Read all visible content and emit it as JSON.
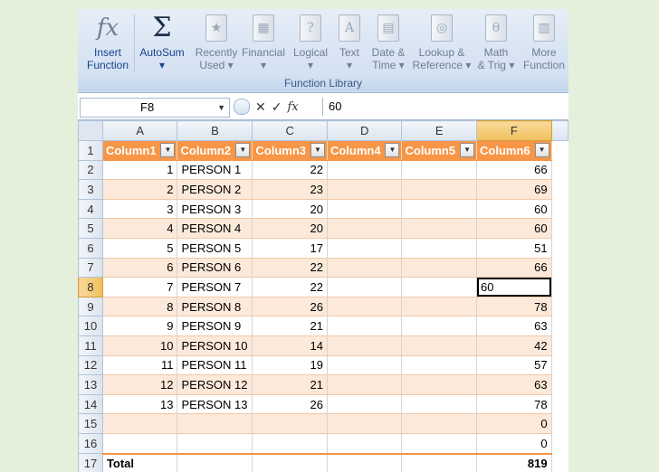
{
  "ribbon": {
    "buttons": [
      {
        "line1": "Insert",
        "line2": "Function",
        "icon": "function-icon"
      },
      {
        "line1": "AutoSum",
        "line2": "▾",
        "icon": "sigma-icon"
      },
      {
        "line1": "Recently",
        "line2": "Used ▾",
        "icon": "book-icon"
      },
      {
        "line1": "Financial",
        "line2": "▾",
        "icon": "book-icon"
      },
      {
        "line1": "Logical",
        "line2": "▾",
        "icon": "book-icon"
      },
      {
        "line1": "Text",
        "line2": "▾",
        "icon": "book-icon"
      },
      {
        "line1": "Date &",
        "line2": "Time ▾",
        "icon": "book-icon"
      },
      {
        "line1": "Lookup &",
        "line2": "Reference ▾",
        "icon": "book-icon"
      },
      {
        "line1": "Math",
        "line2": "& Trig ▾",
        "icon": "book-icon"
      },
      {
        "line1": "More",
        "line2": "Function",
        "icon": "book-icon"
      }
    ],
    "group_label": "Function Library"
  },
  "formula_bar": {
    "name_box": "F8",
    "fx": "fx",
    "value": "60"
  },
  "columns": [
    "A",
    "B",
    "C",
    "D",
    "E",
    "F"
  ],
  "selected_column": "F",
  "selected_row": "8",
  "headers": [
    "Column1",
    "Column2",
    "Column3",
    "Column4",
    "Column5",
    "Column6"
  ],
  "rows": [
    {
      "n": "2",
      "a": "1",
      "b": "PERSON 1",
      "c": "22",
      "f": "66"
    },
    {
      "n": "3",
      "a": "2",
      "b": "PERSON 2",
      "c": "23",
      "f": "69"
    },
    {
      "n": "4",
      "a": "3",
      "b": "PERSON 3",
      "c": "20",
      "f": "60"
    },
    {
      "n": "5",
      "a": "4",
      "b": "PERSON 4",
      "c": "20",
      "f": "60"
    },
    {
      "n": "6",
      "a": "5",
      "b": "PERSON 5",
      "c": "17",
      "f": "51"
    },
    {
      "n": "7",
      "a": "6",
      "b": "PERSON 6",
      "c": "22",
      "f": "66"
    },
    {
      "n": "8",
      "a": "7",
      "b": "PERSON 7",
      "c": "22",
      "f": "60"
    },
    {
      "n": "9",
      "a": "8",
      "b": "PERSON 8",
      "c": "26",
      "f": "78"
    },
    {
      "n": "10",
      "a": "9",
      "b": "PERSON 9",
      "c": "21",
      "f": "63"
    },
    {
      "n": "11",
      "a": "10",
      "b": "PERSON 10",
      "c": "14",
      "f": "42"
    },
    {
      "n": "12",
      "a": "11",
      "b": "PERSON 11",
      "c": "19",
      "f": "57"
    },
    {
      "n": "13",
      "a": "12",
      "b": "PERSON 12",
      "c": "21",
      "f": "63"
    },
    {
      "n": "14",
      "a": "13",
      "b": "PERSON 13",
      "c": "26",
      "f": "78"
    },
    {
      "n": "15",
      "a": "",
      "b": "",
      "c": "",
      "f": "0"
    },
    {
      "n": "16",
      "a": "",
      "b": "",
      "c": "",
      "f": "0"
    }
  ],
  "total_row": {
    "n": "17",
    "label": "Total",
    "f": "819"
  },
  "colors": {
    "header": "#f79646",
    "band": "#fde9d9",
    "selection": "#f1c05e"
  }
}
